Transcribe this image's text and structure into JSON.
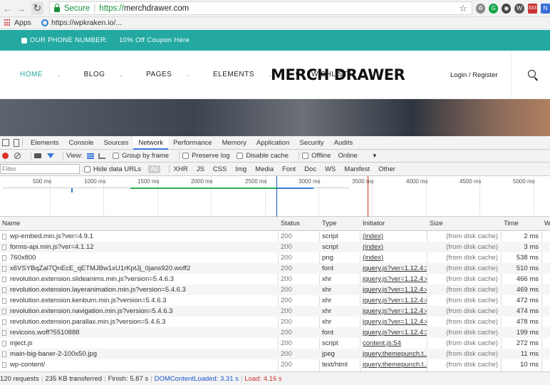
{
  "browser": {
    "secure_label": "Secure",
    "url_scheme": "https://",
    "url_host": "merchdrawer.com",
    "extension_badge": "333"
  },
  "bookmarks": {
    "apps": "Apps",
    "link": "https://wpkraken.io/..."
  },
  "site": {
    "phone_label": "OUR PHONE NUMBER:",
    "coupon": "10% Off Coupon Here",
    "nav": [
      "HOME",
      "BLOG",
      "PAGES",
      "ELEMENTS",
      "WISHLIST"
    ],
    "logo": "MERCH DRAWER",
    "login": "Login / Register",
    "accent": "#24a9a2"
  },
  "devtools": {
    "tabs": [
      "Elements",
      "Console",
      "Sources",
      "Network",
      "Performance",
      "Memory",
      "Application",
      "Security",
      "Audits"
    ],
    "selected_tab": "Network",
    "toolbar": {
      "view_label": "View:",
      "group_by_frame": "Group by frame",
      "preserve_log": "Preserve log",
      "disable_cache": "Disable cache",
      "offline": "Offline",
      "throttle": "Online"
    },
    "filter": {
      "placeholder": "Filter",
      "hide_data_urls": "Hide data URLs",
      "types": [
        "All",
        "XHR",
        "JS",
        "CSS",
        "Img",
        "Media",
        "Font",
        "Doc",
        "WS",
        "Manifest",
        "Other"
      ]
    },
    "overview_ticks": [
      "500 ms",
      "1000 ms",
      "1500 ms",
      "2000 ms",
      "2500 ms",
      "3000 ms",
      "3500 ms",
      "4000 ms",
      "4500 ms",
      "5000 ms"
    ],
    "columns": [
      "Name",
      "Status",
      "Type",
      "Initiator",
      "Size",
      "Time",
      "Wa"
    ],
    "rows": [
      {
        "name": "wp-embed.min.js?ver=4.9.1",
        "status": "200",
        "type": "script",
        "initiator": "(index)",
        "size": "(from disk cache)",
        "time": "2 ms"
      },
      {
        "name": "forms-api.min.js?ver=4.1.12",
        "status": "200",
        "type": "script",
        "initiator": "(index)",
        "size": "(from disk cache)",
        "time": "3 ms"
      },
      {
        "name": "760x800",
        "status": "200",
        "type": "png",
        "initiator": "(index)",
        "size": "(from disk cache)",
        "time": "538 ms"
      },
      {
        "name": "x6VSYBqZal7QnEcE_qETMJBw1xU1rKptJj_0jans920.woff2",
        "status": "200",
        "type": "font",
        "initiator": "jquery.js?ver=1.12.4:3",
        "size": "(from disk cache)",
        "time": "510 ms"
      },
      {
        "name": "revolution.extension.slideanims.min.js?version=5.4.6.3",
        "status": "200",
        "type": "xhr",
        "initiator": "jquery.js?ver=1.12.4:4",
        "size": "(from disk cache)",
        "time": "466 ms"
      },
      {
        "name": "revolution.extension.layeranimation.min.js?version=5.4.6.3",
        "status": "200",
        "type": "xhr",
        "initiator": "jquery.js?ver=1.12.4:4",
        "size": "(from disk cache)",
        "time": "469 ms"
      },
      {
        "name": "revolution.extension.kenburn.min.js?version=5.4.6.3",
        "status": "200",
        "type": "xhr",
        "initiator": "jquery.js?ver=1.12.4:4",
        "size": "(from disk cache)",
        "time": "472 ms"
      },
      {
        "name": "revolution.extension.navigation.min.js?version=5.4.6.3",
        "status": "200",
        "type": "xhr",
        "initiator": "jquery.js?ver=1.12.4:4",
        "size": "(from disk cache)",
        "time": "474 ms"
      },
      {
        "name": "revolution.extension.parallax.min.js?version=5.4.6.3",
        "status": "200",
        "type": "xhr",
        "initiator": "jquery.js?ver=1.12.4:4",
        "size": "(from disk cache)",
        "time": "478 ms"
      },
      {
        "name": "revicons.woff?5510888",
        "status": "200",
        "type": "font",
        "initiator": "jquery.js?ver=1.12.4:3",
        "size": "(from disk cache)",
        "time": "199 ms"
      },
      {
        "name": "inject.js",
        "status": "200",
        "type": "script",
        "initiator": "content.js:54",
        "size": "(from disk cache)",
        "time": "272 ms"
      },
      {
        "name": "main-big-baner-2-100x50.jpg",
        "status": "200",
        "type": "jpeg",
        "initiator": "jquery.themepunch.t...",
        "size": "(from disk cache)",
        "time": "11 ms"
      },
      {
        "name": "wp-content/",
        "status": "200",
        "type": "text/html",
        "initiator": "jquery.themepunch.t...",
        "size": "(from disk cache)",
        "time": "10 ms"
      }
    ],
    "status": {
      "requests": "120 requests",
      "transferred": "235 KB transferred",
      "finish": "Finish: 5.87 s",
      "dom": "DOMContentLoaded: 3.31 s",
      "load": "Load: 4.16 s"
    }
  }
}
